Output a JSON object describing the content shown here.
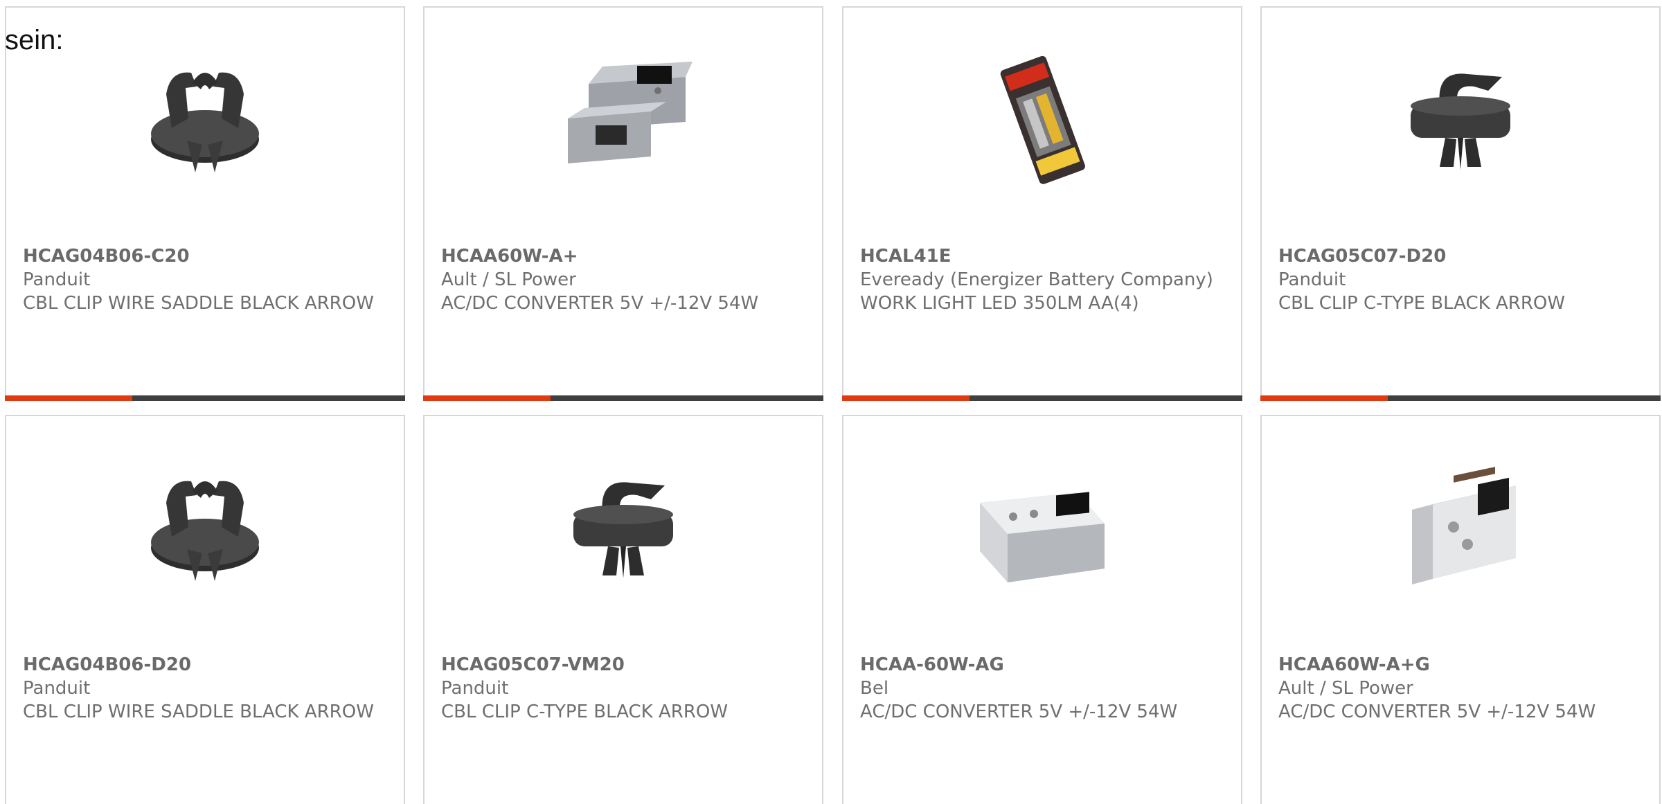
{
  "intro_text": "sein:",
  "products": [
    {
      "part_number": "HCAG04B06-C20",
      "manufacturer": "Panduit",
      "description": "CBL CLIP WIRE SADDLE BLACK ARROW",
      "image": "saddle-clip-icon"
    },
    {
      "part_number": "HCAA60W-A+",
      "manufacturer": "Ault / SL Power",
      "description": "AC/DC CONVERTER 5V +/-12V 54W",
      "image": "open-frame-power-supply-icon"
    },
    {
      "part_number": "HCAL41E",
      "manufacturer": "Eveready (Energizer Battery Company)",
      "description": "WORK LIGHT LED 350LM AA(4)",
      "image": "work-light-package-icon"
    },
    {
      "part_number": "HCAG05C07-D20",
      "manufacturer": "Panduit",
      "description": "CBL CLIP C-TYPE BLACK ARROW",
      "image": "c-type-clip-icon"
    },
    {
      "part_number": "HCAG04B06-D20",
      "manufacturer": "Panduit",
      "description": "CBL CLIP WIRE SADDLE BLACK ARROW",
      "image": "saddle-clip-icon"
    },
    {
      "part_number": "HCAG05C07-VM20",
      "manufacturer": "Panduit",
      "description": "CBL CLIP C-TYPE BLACK ARROW",
      "image": "c-type-clip-icon"
    },
    {
      "part_number": "HCAA-60W-AG",
      "manufacturer": "Bel",
      "description": "AC/DC CONVERTER 5V +/-12V 54W",
      "image": "power-supply-box-icon"
    },
    {
      "part_number": "HCAA60W-A+G",
      "manufacturer": "Ault / SL Power",
      "description": "AC/DC CONVERTER 5V +/-12V 54W",
      "image": "bracket-power-supply-icon"
    }
  ],
  "colors": {
    "accent": "#e03a12",
    "bar": "#3f3f3f",
    "text": "#6f6f6f",
    "card_border": "#d7d7d7"
  }
}
